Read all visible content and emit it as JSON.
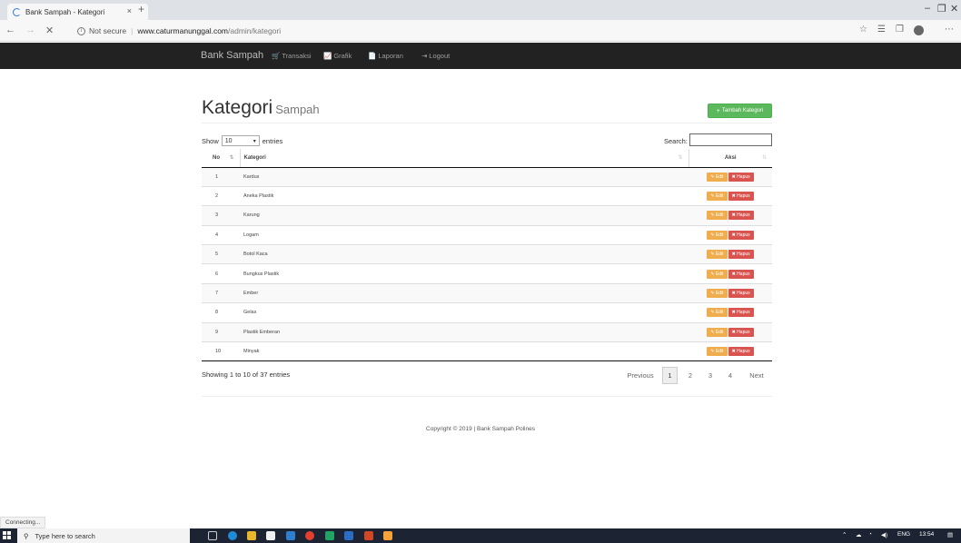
{
  "browser": {
    "tab_title": "Bank Sampah - Kategori",
    "tab_close": "×",
    "new_tab": "+",
    "window_controls": [
      "–",
      "❐",
      "✕"
    ],
    "address": {
      "security": "Not secure",
      "host": "www.caturmanunggal.com",
      "path": "/admin/kategori"
    },
    "status_text": "Connecting..."
  },
  "navbar": {
    "brand": "Bank Sampah",
    "links": [
      {
        "icon": "cart-icon",
        "glyph": "🛒",
        "label": "Transaksi"
      },
      {
        "icon": "chart-icon",
        "glyph": "📈",
        "label": "Grafik"
      },
      {
        "icon": "file-icon",
        "glyph": "📄",
        "label": "Laporan"
      },
      {
        "icon": "logout-icon",
        "glyph": "⇥",
        "label": "Logout"
      }
    ]
  },
  "page": {
    "title": "Kategori",
    "subtitle": "Sampah",
    "add_button": "Tambah Kategori",
    "show_label": "Show",
    "show_value": "10",
    "entries_label": "entries",
    "search_label": "Search:",
    "search_value": "",
    "columns": [
      "No",
      "Kategori",
      "Aksi"
    ],
    "rows": [
      {
        "no": "1",
        "kategori": "Kardus"
      },
      {
        "no": "2",
        "kategori": "Aneka Plastik"
      },
      {
        "no": "3",
        "kategori": "Karung"
      },
      {
        "no": "4",
        "kategori": "Logam"
      },
      {
        "no": "5",
        "kategori": "Botol Kaca"
      },
      {
        "no": "6",
        "kategori": "Bungkus Plastik"
      },
      {
        "no": "7",
        "kategori": "Ember"
      },
      {
        "no": "8",
        "kategori": "Gelas"
      },
      {
        "no": "9",
        "kategori": "Plastik Emberan"
      },
      {
        "no": "10",
        "kategori": "Minyak"
      }
    ],
    "edit_label": "Edit",
    "delete_label": "Hapus",
    "info": "Showing 1 to 10 of 37 entries",
    "pagination": {
      "previous": "Previous",
      "pages": [
        "1",
        "2",
        "3",
        "4"
      ],
      "next": "Next"
    },
    "copyright": "Copyright © 2019 | Bank Sampah Polines"
  },
  "taskbar": {
    "search_placeholder": "Type here to search",
    "language": "ENG",
    "time": "13:54"
  },
  "colors": {
    "navbar": "#222222",
    "success": "#5cb85c",
    "warning": "#f0ad4e",
    "danger": "#d9534f"
  }
}
